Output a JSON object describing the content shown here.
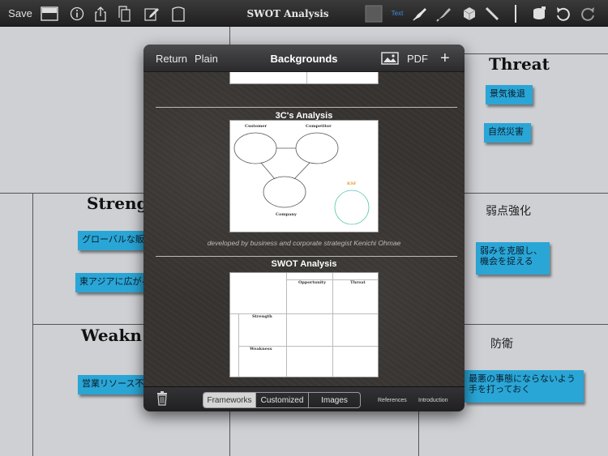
{
  "toolbar": {
    "save_label": "Save",
    "title": "SWOT Analysis",
    "text_tool_label": "Text",
    "icons": [
      "layout-icon",
      "info-icon",
      "share-icon",
      "copy-icon",
      "edit-icon",
      "paper-icon",
      "color-swatch-icon",
      "text-tool",
      "pen-icon",
      "marker-icon",
      "eraser-icon",
      "pencil-icon",
      "line-icon",
      "stamp-icon",
      "undo-icon",
      "redo-icon"
    ]
  },
  "canvas": {
    "sections": {
      "threat": "Threat",
      "strength": "Streng",
      "weakness": "Weakn",
      "weakness_reinforce": "弱点強化",
      "defense": "防衛"
    },
    "stickies": {
      "threat_1": "景気後退",
      "threat_2": "自然災害",
      "strength_1": "グローバルな販売",
      "strength_2": "東アジアに広がる",
      "weakness_1": "営業リソース不足",
      "reinforce_1": "弱みを克服し、機会を捉える",
      "defense_1": "最悪の事態にならないよう手を打っておく"
    },
    "colors": {
      "sticky": "#2aa6d6",
      "background": "#cfd0d4",
      "grid_line": "#555555"
    }
  },
  "popover": {
    "return_label": "Return",
    "plain_label": "Plain",
    "title": "Backgrounds",
    "pdf_label": "PDF",
    "add_label": "+",
    "templates": [
      {
        "title": "3C's Analysis",
        "description": "developed by business and corporate strategist Kenichi Ohmae",
        "labels": {
          "customer": "Customer",
          "competitor": "Competitor",
          "company": "Company",
          "ksf": "KSF"
        }
      },
      {
        "title": "SWOT Analysis",
        "labels": {
          "opportunity": "Opportunity",
          "threat": "Threat",
          "strength": "Strength",
          "weakness": "Weakness"
        }
      }
    ],
    "footer": {
      "tabs": [
        "Frameworks",
        "Customized",
        "Images"
      ],
      "selected_tab": "Frameworks",
      "references_label": "References",
      "introduction_label": "Introduction"
    }
  }
}
